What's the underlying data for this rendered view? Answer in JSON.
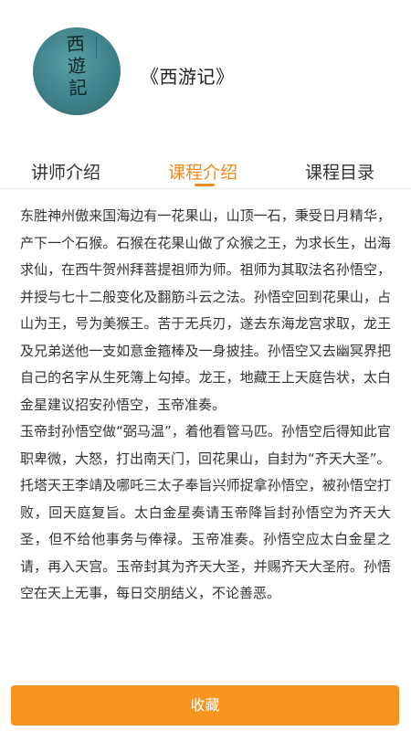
{
  "book": {
    "cover_calligraphy": [
      "西",
      "遊",
      "記"
    ],
    "title": "《西游记》"
  },
  "tabs": [
    {
      "label": "讲师介绍",
      "active": false
    },
    {
      "label": "课程介绍",
      "active": true
    },
    {
      "label": "课程目录",
      "active": false
    }
  ],
  "accent_color": "#f7941d",
  "content": {
    "paragraphs": [
      "东胜神州傲来国海边有一花果山，山顶一石，秉受日月精华，产下一个石猴。石猴在花果山做了众猴之王，为求长生，出海求仙，在西牛贺州拜菩提祖师为师。祖师为其取法名孙悟空，并授与七十二般变化及翻筋斗云之法。孙悟空回到花果山，占山为王，号为美猴王。苦于无兵刃，遂去东海龙宫求取，龙王及兄弟送他一支如意金箍棒及一身披挂。孙悟空又去幽冥界把自己的名字从生死簿上勾掉。龙王，地藏王上天庭告状，太白金星建议招安孙悟空，玉帝准奏。",
      "玉帝封孙悟空做“弼马温”，着他看管马匹。孙悟空后得知此官职卑微，大怒，打出南天门，回花果山，自封为“齐天大圣”。",
      "托塔天王李靖及哪吒三太子奉旨兴师捉拿孙悟空，被孙悟空打败，回天庭复旨。太白金星奏请玉帝降旨封孙悟空为齐天大圣，但不给他事务与俸禄。玉帝准奏。孙悟空应太白金星之请，再入天宫。玉帝封其为齐天大圣，并赐齐天大圣府。孙悟空在天上无事，每日交朋结义，不论善恶。"
    ]
  },
  "favorite_button": {
    "label": "收藏"
  }
}
